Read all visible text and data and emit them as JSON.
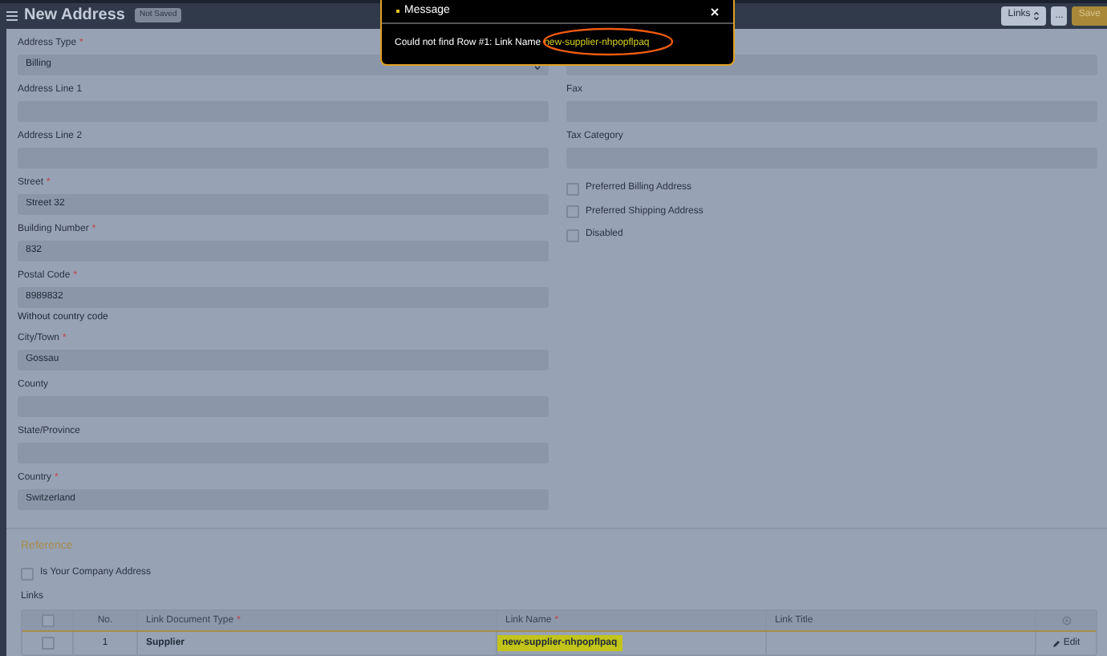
{
  "header": {
    "title": "New Address",
    "status_badge": "Not Saved",
    "buttons": [
      {
        "label": "Links",
        "kind": "dropdown"
      },
      {
        "label": "...",
        "kind": "more"
      },
      {
        "label": "Save",
        "kind": "primary"
      }
    ]
  },
  "left_fields": [
    {
      "kind": "select",
      "label": "Address Type",
      "mark": "*",
      "value": "Billing"
    },
    {
      "kind": "input",
      "label": "Address Line 1"
    },
    {
      "kind": "input",
      "label": "Address Line 2"
    },
    {
      "kind": "input",
      "label": "Street",
      "mark": "*",
      "value": "Street 32"
    },
    {
      "kind": "input",
      "label": "Building Number",
      "mark": "*",
      "value": "832"
    },
    {
      "kind": "input",
      "label": "Postal Code",
      "mark": "*",
      "value": "8989832",
      "description": "Without country code"
    },
    {
      "kind": "input",
      "label": "City/Town",
      "mark": "*",
      "value": "Gossau"
    },
    {
      "kind": "input",
      "label": "County"
    },
    {
      "kind": "input",
      "label": "State/Province"
    },
    {
      "kind": "input",
      "label": "Country",
      "mark": "*",
      "value": "Switzerland"
    }
  ],
  "right_fields": [
    {
      "kind": "input"
    },
    {
      "kind": "input",
      "label": "Fax"
    },
    {
      "kind": "input",
      "label": "Tax Category"
    },
    {
      "kind": "checkbox",
      "label": "Preferred Billing Address",
      "checked": false
    },
    {
      "kind": "checkbox",
      "label": "Preferred Shipping Address",
      "checked": false
    },
    {
      "kind": "checkbox",
      "label": "Disabled",
      "checked": false
    }
  ],
  "reference": {
    "title": "Reference",
    "checkbox": {
      "label": "Is Your Company Address",
      "checked": false
    },
    "links_label": "Links",
    "table": {
      "select_all": {
        "checked": false
      },
      "columns": [
        {
          "label": "No."
        },
        {
          "label": "Link Document Type",
          "mark": "*"
        },
        {
          "label": "Link Name",
          "mark": "*"
        },
        {
          "label": "Link Title"
        }
      ],
      "rows": [
        {
          "selected": false,
          "no": "1",
          "link_document_type": "Supplier",
          "link_name": "new-supplier-nhpopflpaq",
          "action": "Edit"
        }
      ]
    }
  },
  "message": {
    "title": "Message",
    "body": "Could not find Row #1: Link Name",
    "link_name": "new-supplier-nhpopflpaq"
  }
}
